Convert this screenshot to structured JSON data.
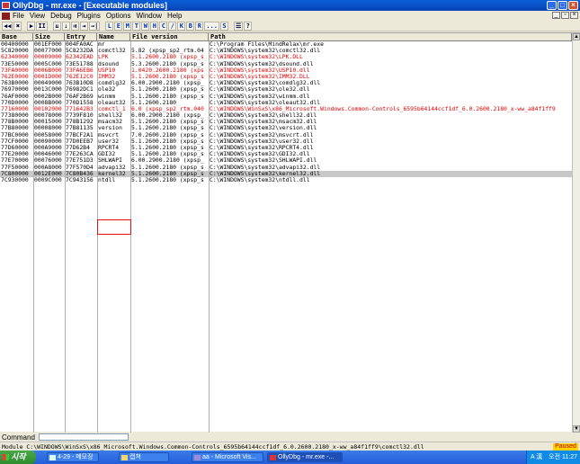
{
  "window": {
    "title": "OllyDbg - mr.exe - [Executable modules]"
  },
  "menu": {
    "items": [
      "File",
      "View",
      "Debug",
      "Plugins",
      "Options",
      "Window",
      "Help"
    ]
  },
  "toolbar": {
    "buttons": [
      "◀◀",
      "✖",
      "▶",
      "II",
      "⇊",
      "⇣",
      "⇉",
      "⇥",
      "→|",
      "L",
      "E",
      "M",
      "T",
      "W",
      "H",
      "C",
      "/",
      "K",
      "B",
      "R",
      "...",
      "S",
      "☰",
      "?"
    ]
  },
  "table": {
    "headers": [
      "Base",
      "Size",
      "Entry",
      "Name",
      "File version",
      "Path"
    ],
    "rows": [
      {
        "base": "00400000",
        "size": "001EF000",
        "entry": "004FA0AC",
        "name": "mr",
        "ver": "",
        "path": "C:\\Program Files\\MindRelax\\mr.exe",
        "style": "normal"
      },
      {
        "base": "5C820000",
        "size": "00077000",
        "entry": "5C8232DA",
        "name": "comctl32",
        "ver": "5.82 (xpsp_sp2_rtm.04",
        "path": "C:\\WINDOWS\\system32\\comctl32.dll",
        "style": "normal"
      },
      {
        "base": "62340000",
        "size": "00009000",
        "entry": "62342EAD",
        "name": "LPK",
        "ver": "5.1.2600.2180 (xpsp_s",
        "path": "C:\\WINDOWS\\system32\\LPK.DLL",
        "style": "red"
      },
      {
        "base": "73E50000",
        "size": "0005C000",
        "entry": "73E51788",
        "name": "dsound",
        "ver": "5.3.2600.2180 (xpsp_s",
        "path": "C:\\WINDOWS\\system32\\dsound.dll",
        "style": "normal"
      },
      {
        "base": "73FA0000",
        "size": "0006B000",
        "entry": "73FA6EB6",
        "name": "USP10",
        "ver": "1.0420.2600.2180 (xps",
        "path": "C:\\WINDOWS\\system32\\USP10.dll",
        "style": "red"
      },
      {
        "base": "762E0000",
        "size": "0001D000",
        "entry": "762E12C0",
        "name": "IMM32",
        "ver": "5.1.2600.2180 (xpsp_s",
        "path": "C:\\WINDOWS\\system32\\IMM32.DLL",
        "style": "red"
      },
      {
        "base": "763B0000",
        "size": "00049000",
        "entry": "763B10D8",
        "name": "comdlg32",
        "ver": "6.00.2900.2180 (xpsp_",
        "path": "C:\\WINDOWS\\system32\\comdlg32.dll",
        "style": "normal"
      },
      {
        "base": "76970000",
        "size": "0013C000",
        "entry": "76982DC1",
        "name": "ole32",
        "ver": "5.1.2600.2180 (xpsp_s",
        "path": "C:\\WINDOWS\\system32\\ole32.dll",
        "style": "normal"
      },
      {
        "base": "76AF0000",
        "size": "0002B000",
        "entry": "76AF2B69",
        "name": "winmm",
        "ver": "5.1.2600.2180 (xpsp_s",
        "path": "C:\\WINDOWS\\system32\\winmm.dll",
        "style": "normal"
      },
      {
        "base": "770D0000",
        "size": "0008B000",
        "entry": "770D1558",
        "name": "oleaut32",
        "ver": "5.1.2600.2180",
        "path": "C:\\WINDOWS\\system32\\oleaut32.dll",
        "style": "normal"
      },
      {
        "base": "77160000",
        "size": "00102000",
        "entry": "771642B3",
        "name": "comctl_1",
        "ver": "6.0 (xpsp_sp2_rtm.040",
        "path": "C:\\WINDOWS\\WinSxS\\x86_Microsoft.Windows.Common-Controls_6595b64144ccf1df_6.0.2600.2180_x-ww_a84f1ff9",
        "style": "red"
      },
      {
        "base": "77380000",
        "size": "00078000",
        "entry": "7739F810",
        "name": "shell32",
        "ver": "6.00.2900.2180 (xpsp_",
        "path": "C:\\WINDOWS\\system32\\shell32.dll",
        "style": "normal"
      },
      {
        "base": "778B0000",
        "size": "00015000",
        "entry": "778B1292",
        "name": "msacm32",
        "ver": "5.1.2600.2180 (xpsp_s",
        "path": "C:\\WINDOWS\\system32\\msacm32.dll",
        "style": "normal"
      },
      {
        "base": "77B80000",
        "size": "00008000",
        "entry": "77B81135",
        "name": "version",
        "ver": "5.1.2600.2180 (xpsp_s",
        "path": "C:\\WINDOWS\\system32\\version.dll",
        "style": "normal"
      },
      {
        "base": "77BC0000",
        "size": "00058000",
        "entry": "77BCF2A1",
        "name": "msvcrt",
        "ver": "7.0.2600.2180 (xpsp_s",
        "path": "C:\\WINDOWS\\system32\\msvcrt.dll",
        "style": "normal"
      },
      {
        "base": "77CF0000",
        "size": "00090000",
        "entry": "77D0EEB7",
        "name": "user32",
        "ver": "5.1.2600.2180 (xpsp_s",
        "path": "C:\\WINDOWS\\system32\\user32.dll",
        "style": "normal"
      },
      {
        "base": "77D60000",
        "size": "000A9000",
        "entry": "77D62B4",
        "name": "RPCRT4",
        "ver": "5.1.2600.2180 (xpsp_s",
        "path": "C:\\WINDOWS\\system32\\RPCRT4.dll",
        "style": "normal"
      },
      {
        "base": "77E20000",
        "size": "00046000",
        "entry": "77E263CA",
        "name": "GDI32",
        "ver": "5.1.2600.2180 (xpsp_s",
        "path": "C:\\WINDOWS\\system32\\GDI32.dll",
        "style": "normal"
      },
      {
        "base": "77E70000",
        "size": "00076000",
        "entry": "77E751D3",
        "name": "SHLWAPI",
        "ver": "6.00.2900.2180 (xpsp_",
        "path": "C:\\WINDOWS\\system32\\SHLWAPI.dll",
        "style": "normal"
      },
      {
        "base": "77F50000",
        "size": "000A8000",
        "entry": "77F570D4",
        "name": "advapi32",
        "ver": "5.1.2600.2180 (xpsp_s",
        "path": "C:\\WINDOWS\\system32\\advapi32.dll",
        "style": "normal"
      },
      {
        "base": "7C800000",
        "size": "0012E000",
        "entry": "7C80B436",
        "name": "kernel32",
        "ver": "5.1.2600.2180 (xpsp_s",
        "path": "C:\\WINDOWS\\system32\\kernel32.dll",
        "style": "sel"
      },
      {
        "base": "7C930000",
        "size": "0009C000",
        "entry": "7C943156",
        "name": "ntdll",
        "ver": "5.1.2600.2180 (xpsp_s",
        "path": "C:\\WINDOWS\\system32\\ntdll.dll",
        "style": "normal"
      }
    ]
  },
  "command": {
    "label": "Command"
  },
  "status": {
    "text": "Module C:\\WINDOWS\\WinSxS\\x86_Microsoft.Windows.Common-Controls_6595b64144ccf1df_6.0.2600.2180_x-ww_a84f1ff9\\comctl32.dll",
    "state": "Paused"
  },
  "taskbar": {
    "start": "시작",
    "buttons": [
      "4-29 - 메모장",
      "캡쳐",
      "aa - Microsoft Vis...",
      "OllyDbg - mr.exe -..."
    ],
    "lang": "A 漢",
    "clock": "오전 11:27"
  }
}
